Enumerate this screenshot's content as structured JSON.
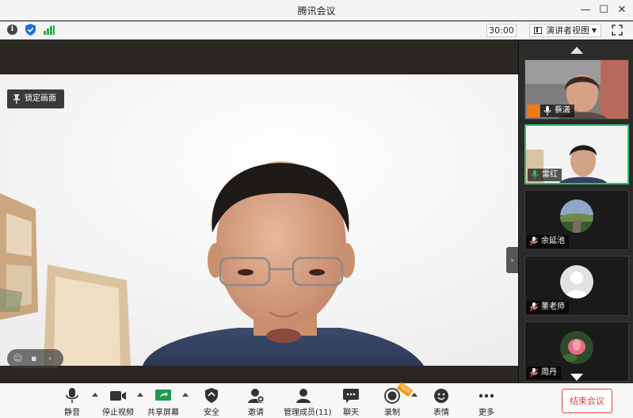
{
  "window": {
    "title": "腾讯会议"
  },
  "infobar": {
    "timer": "30:00",
    "view_mode": "演讲者视图"
  },
  "main": {
    "lock_view_label": "锁定画面"
  },
  "participants": [
    {
      "name": "蔡潇",
      "is_host": true,
      "active": false
    },
    {
      "name": "雷红",
      "is_host": false,
      "active": true
    },
    {
      "name": "余延池",
      "is_host": false,
      "active": false
    },
    {
      "name": "董老师",
      "is_host": false,
      "active": false
    },
    {
      "name": "周丹",
      "is_host": false,
      "active": false
    }
  ],
  "toolbar": {
    "mute": "静音",
    "stop_video": "停止视频",
    "share_screen": "共享屏幕",
    "security": "安全",
    "invite": "邀请",
    "manage_members": "管理成员(11)",
    "chat": "聊天",
    "record": "录制",
    "reactions": "表情",
    "more": "更多",
    "end_meeting": "结束会议"
  },
  "colors": {
    "accent_green": "#2dbf6c",
    "end_red": "#e0403a",
    "host_orange": "#f07a16"
  }
}
